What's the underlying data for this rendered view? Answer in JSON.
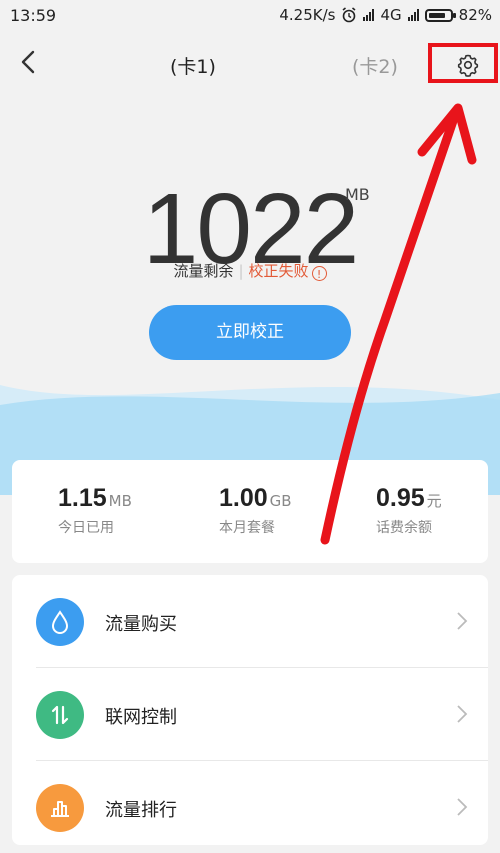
{
  "status": {
    "time": "13:59",
    "speed": "4.25K/s",
    "network": "4G",
    "battery": "82%",
    "battery_level": 0.82
  },
  "header": {
    "tab1": "(卡1)",
    "tab2": "(卡2)"
  },
  "usage": {
    "value": "1022",
    "unit": "MB",
    "label": "流量剩余",
    "error": "校正失败",
    "warn_symbol": "!"
  },
  "calibrate_button": "立即校正",
  "stats": [
    {
      "value": "1.15",
      "unit": "MB",
      "label": "今日已用"
    },
    {
      "value": "1.00",
      "unit": "GB",
      "label": "本月套餐"
    },
    {
      "value": "0.95",
      "unit": "元",
      "label": "话费余额"
    }
  ],
  "menu": [
    {
      "label": "流量购买",
      "icon": "droplet-icon",
      "color": "#3c9df0"
    },
    {
      "label": "联网控制",
      "icon": "network-control-icon",
      "color": "#3fba83"
    },
    {
      "label": "流量排行",
      "icon": "ranking-chart-icon",
      "color": "#f79a3e"
    }
  ],
  "colors": {
    "accent": "#3c9df0",
    "error": "#e25a37",
    "highlight": "#e8141b"
  }
}
